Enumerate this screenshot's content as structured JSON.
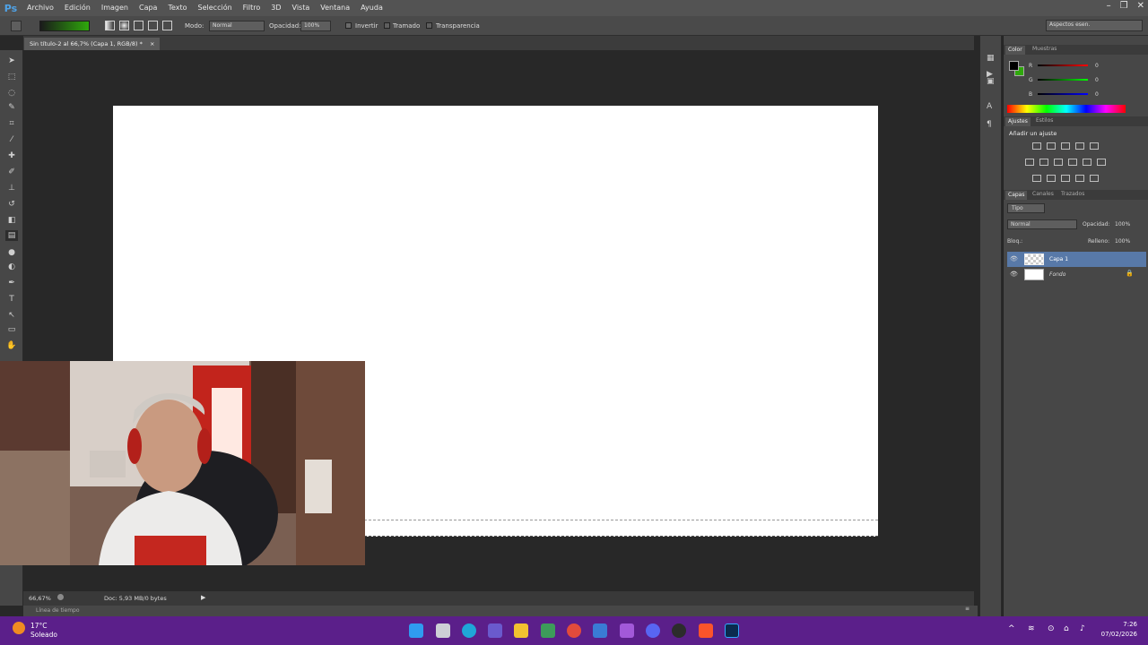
{
  "app": {
    "logo": "Ps"
  },
  "menu": [
    "Archivo",
    "Edición",
    "Imagen",
    "Capa",
    "Texto",
    "Selección",
    "Filtro",
    "3D",
    "Vista",
    "Ventana",
    "Ayuda"
  ],
  "window_controls": [
    "minimize-icon",
    "restore-icon",
    "close-icon"
  ],
  "options": {
    "modo_label": "Modo:",
    "modo_value": "Normal",
    "opacidad_label": "Opacidad:",
    "opacidad_value": "100%",
    "invertir": "Invertir",
    "tramado": "Tramado",
    "transparencia": "Transparencia",
    "workspace": "Aspectos esen.",
    "gradient_colors": [
      "#1a1a1a",
      "#2fa80c"
    ]
  },
  "document": {
    "tab_title": "Sin título-2 al 66,7% (Capa 1, RGB/8) *",
    "tab_close": "×"
  },
  "status": {
    "zoom": "66,67%",
    "doc": "Doc: 5,93 MB/0 bytes",
    "timeline": "Línea de tiempo"
  },
  "color_panel": {
    "tabs": [
      "Color",
      "Muestras"
    ],
    "channels": [
      {
        "name": "R",
        "value": "0"
      },
      {
        "name": "G",
        "value": "0"
      },
      {
        "name": "B",
        "value": "0"
      }
    ]
  },
  "adjust_panel": {
    "tabs": [
      "Ajustes",
      "Estilos"
    ],
    "heading": "Añadir un ajuste"
  },
  "layers_panel": {
    "tabs": [
      "Capas",
      "Canales",
      "Trazados"
    ],
    "filter": "Tipo",
    "blend": "Normal",
    "opacity_label": "Opacidad:",
    "opacity_value": "100%",
    "lock_label": "Bloq.:",
    "fill_label": "Relleno:",
    "fill_value": "100%",
    "layers": [
      {
        "name": "Capa 1",
        "selected": true
      },
      {
        "name": "Fondo",
        "selected": false
      }
    ]
  },
  "taskbar": {
    "weather_temp": "17°C",
    "weather_desc": "Soleado",
    "time": "7:26",
    "date": "07/02/2026",
    "color": "#5b1f8a"
  }
}
